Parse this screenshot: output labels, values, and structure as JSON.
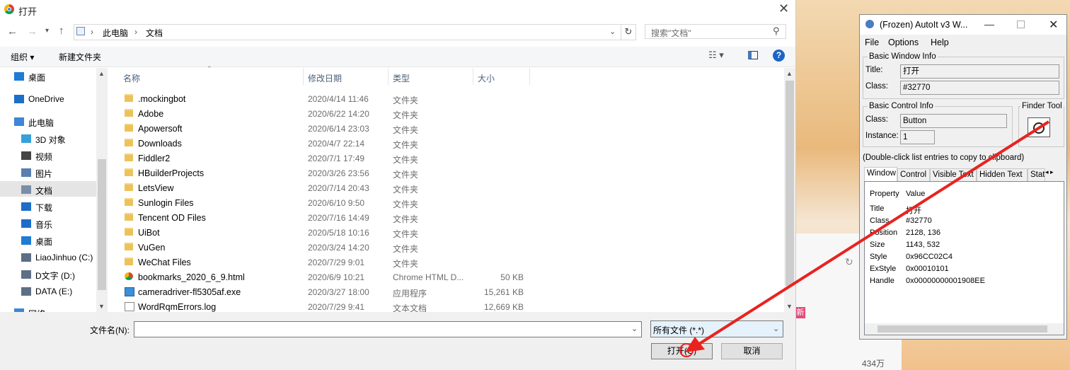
{
  "background": {
    "count_text": "434万",
    "badge_text": "新"
  },
  "dialog": {
    "title": "打开",
    "address": [
      "此电脑",
      "文档"
    ],
    "search_placeholder": "搜索\"文档\"",
    "toolbar": {
      "organize": "组织 ▾",
      "new_folder": "新建文件夹"
    },
    "nav_items": [
      {
        "label": "桌面",
        "icon": "desktop-icon",
        "color": "#1e7bd6"
      },
      {
        "label": "OneDrive",
        "icon": "cloud-icon",
        "color": "#1b6fc6"
      },
      {
        "label": "此电脑",
        "icon": "computer-icon",
        "color": "#3d86d8"
      },
      {
        "label": "3D 对象",
        "icon": "3d-objects-icon",
        "color": "#37a0d8"
      },
      {
        "label": "视频",
        "icon": "video-icon",
        "color": "#444"
      },
      {
        "label": "图片",
        "icon": "pictures-icon",
        "color": "#5a7fb0"
      },
      {
        "label": "文档",
        "icon": "documents-icon",
        "color": "#7a8ea8"
      },
      {
        "label": "下载",
        "icon": "download-icon",
        "color": "#1e6dc8"
      },
      {
        "label": "音乐",
        "icon": "music-icon",
        "color": "#1e6dc8"
      },
      {
        "label": "桌面",
        "icon": "desktop-icon",
        "color": "#1e7bd6"
      },
      {
        "label": "LiaoJinhuo (C:)",
        "icon": "drive-icon",
        "color": "#5c6f85"
      },
      {
        "label": "D文字 (D:)",
        "icon": "drive-icon",
        "color": "#5c6f85"
      },
      {
        "label": "DATA (E:)",
        "icon": "drive-icon",
        "color": "#5c6f85"
      },
      {
        "label": "网络",
        "icon": "network-icon",
        "color": "#3d86d8"
      }
    ],
    "columns": {
      "name": "名称",
      "date": "修改日期",
      "type": "类型",
      "size": "大小"
    },
    "files": [
      {
        "name": ".mockingbot",
        "date": "2020/4/14 11:46",
        "type": "文件夹",
        "size": "",
        "kind": "folder"
      },
      {
        "name": "Adobe",
        "date": "2020/6/22 14:20",
        "type": "文件夹",
        "size": "",
        "kind": "folder"
      },
      {
        "name": "Apowersoft",
        "date": "2020/6/14 23:03",
        "type": "文件夹",
        "size": "",
        "kind": "folder"
      },
      {
        "name": "Downloads",
        "date": "2020/4/7 22:14",
        "type": "文件夹",
        "size": "",
        "kind": "folder"
      },
      {
        "name": "Fiddler2",
        "date": "2020/7/1 17:49",
        "type": "文件夹",
        "size": "",
        "kind": "folder"
      },
      {
        "name": "HBuilderProjects",
        "date": "2020/3/26 23:56",
        "type": "文件夹",
        "size": "",
        "kind": "folder"
      },
      {
        "name": "LetsView",
        "date": "2020/7/14 20:43",
        "type": "文件夹",
        "size": "",
        "kind": "folder"
      },
      {
        "name": "Sunlogin Files",
        "date": "2020/6/10 9:50",
        "type": "文件夹",
        "size": "",
        "kind": "folder"
      },
      {
        "name": "Tencent OD Files",
        "date": "2020/7/16 14:49",
        "type": "文件夹",
        "size": "",
        "kind": "folder"
      },
      {
        "name": "UiBot",
        "date": "2020/5/18 10:16",
        "type": "文件夹",
        "size": "",
        "kind": "folder"
      },
      {
        "name": "VuGen",
        "date": "2020/3/24 14:20",
        "type": "文件夹",
        "size": "",
        "kind": "folder"
      },
      {
        "name": "WeChat Files",
        "date": "2020/7/29 9:01",
        "type": "文件夹",
        "size": "",
        "kind": "folder"
      },
      {
        "name": "bookmarks_2020_6_9.html",
        "date": "2020/6/9 10:21",
        "type": "Chrome HTML D...",
        "size": "50 KB",
        "kind": "chrome"
      },
      {
        "name": "cameradriver-fl5305af.exe",
        "date": "2020/3/27 18:00",
        "type": "应用程序",
        "size": "15,261 KB",
        "kind": "exe"
      },
      {
        "name": "WordRqmErrors.log",
        "date": "2020/7/29 9:41",
        "type": "文本文档",
        "size": "12,669 KB",
        "kind": "text"
      }
    ],
    "filename_label": "文件名(N):",
    "filename_value": "",
    "filetype_value": "所有文件 (*.*)",
    "open_button": "打开(O)",
    "cancel_button": "取消"
  },
  "autoit": {
    "title": "(Frozen) AutoIt v3 W...",
    "menu": [
      "File",
      "Options",
      "Help"
    ],
    "basic_window_info": "Basic Window Info",
    "title_label": "Title:",
    "title_value": "打开",
    "class_label": "Class:",
    "class_value": "#32770",
    "basic_control_info": "Basic Control Info",
    "ctrl_class_label": "Class:",
    "ctrl_class_value": "Button",
    "instance_label": "Instance:",
    "instance_value": "1",
    "finder_tool": "Finder Tool",
    "hint": "(Double-click list entries to copy to clipboard)",
    "tabs": [
      "Window",
      "Control",
      "Visible Text",
      "Hidden Text",
      "Stat"
    ],
    "list_headers": {
      "property": "Property",
      "value": "Value"
    },
    "properties": [
      {
        "property": "Title",
        "value": "打开"
      },
      {
        "property": "Class",
        "value": "#32770"
      },
      {
        "property": "Position",
        "value": "2128, 136"
      },
      {
        "property": "Size",
        "value": "1143, 532"
      },
      {
        "property": "Style",
        "value": "0x96CC02C4"
      },
      {
        "property": "ExStyle",
        "value": "0x00010101"
      },
      {
        "property": "Handle",
        "value": "0x00000000001908EE"
      }
    ]
  },
  "colors": {
    "annotation_arrow": "#e8231f",
    "accent": "#1d64c8"
  }
}
